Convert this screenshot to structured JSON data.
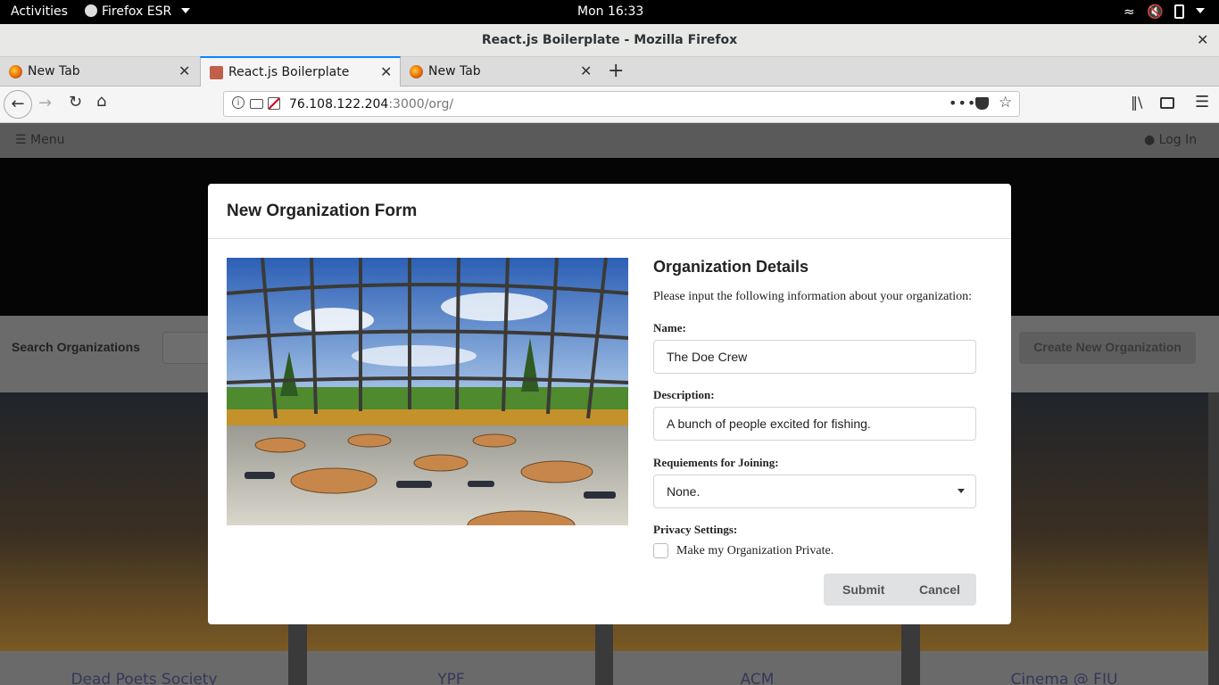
{
  "system": {
    "activities": "Activities",
    "app": "Firefox ESR",
    "clock": "Mon 16:33"
  },
  "window": {
    "title": "React.js Boilerplate - Mozilla Firefox"
  },
  "tabs": [
    {
      "label": "New Tab"
    },
    {
      "label": "React.js Boilerplate"
    },
    {
      "label": "New Tab"
    }
  ],
  "url": {
    "host": "76.108.122.204",
    "path": ":3000/org/"
  },
  "page": {
    "menu_label": "Menu",
    "login_label": "Log In",
    "search_label": "Search Organizations",
    "create_label": "Create New Organization",
    "cards": [
      "Dead Poets Society",
      "YPF",
      "ACM",
      "Cinema @ FIU"
    ]
  },
  "modal": {
    "title": "New Organization Form",
    "section_title": "Organization Details",
    "intro": "Please input the following information about your organization:",
    "name_label": "Name:",
    "name_value": "The Doe Crew",
    "description_label": "Description:",
    "description_value": "A bunch of people excited for fishing.",
    "requirements_label": "Requiements for Joining:",
    "requirements_value": "None.",
    "privacy_label": "Privacy Settings:",
    "privacy_option": "Make my Organization Private.",
    "privacy_checked": false,
    "submit": "Submit",
    "cancel": "Cancel"
  },
  "colors": {
    "accent": "#0a84ff",
    "overlay": "#6a6a6a"
  }
}
